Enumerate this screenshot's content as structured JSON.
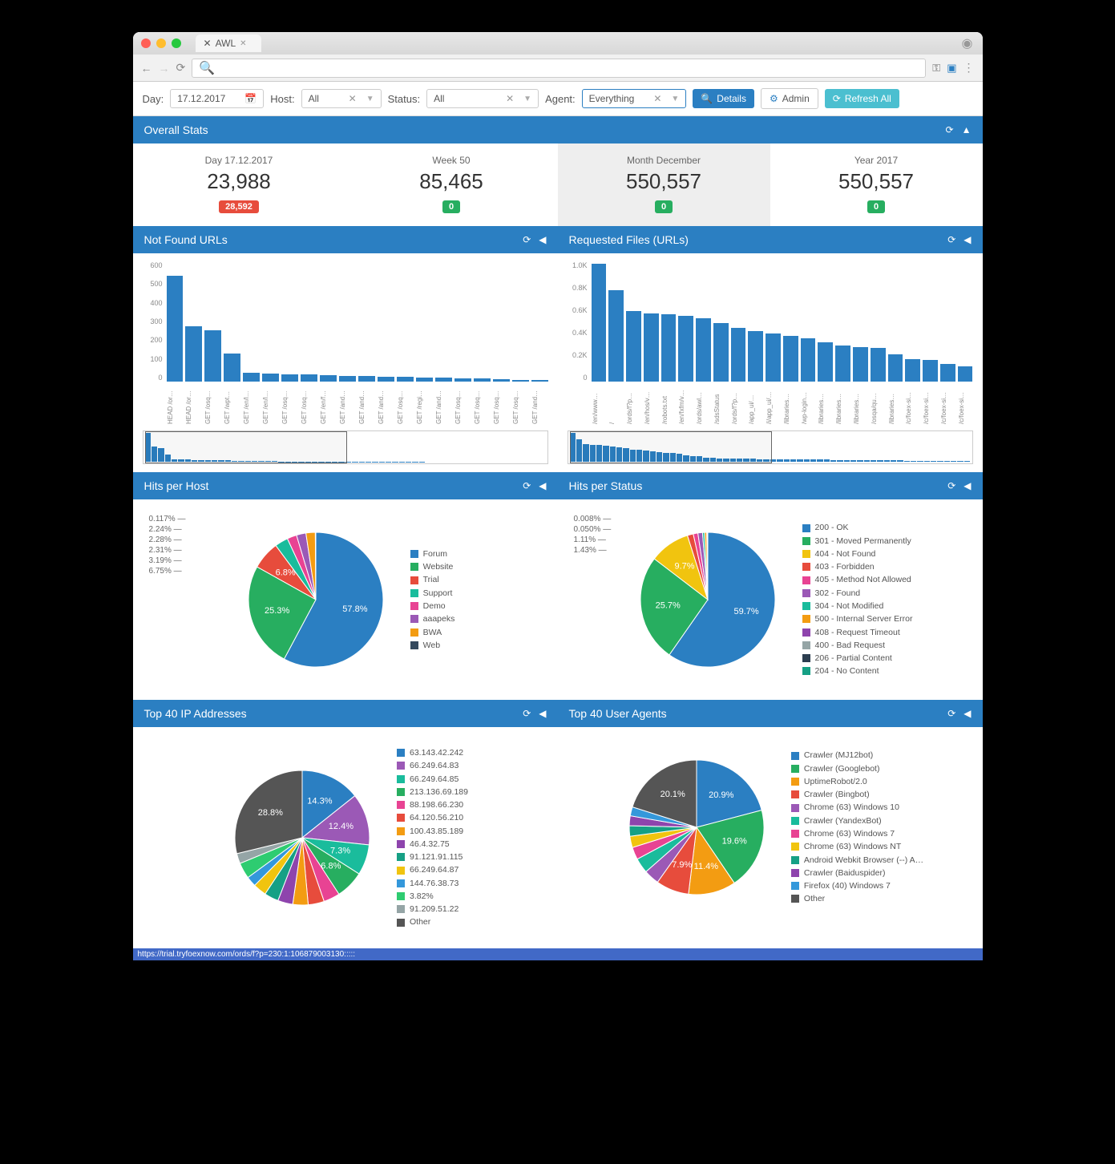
{
  "browser": {
    "tab_title": "AWL",
    "status_text": "https://trial.tryfoexnow.com/ords/f?p=230:1:106879003130:::::"
  },
  "filters": {
    "day_label": "Day:",
    "day_value": "17.12.2017",
    "host_label": "Host:",
    "host_value": "All",
    "status_label": "Status:",
    "status_value": "All",
    "agent_label": "Agent:",
    "agent_value": "Everything",
    "details_btn": "Details",
    "admin_btn": "Admin",
    "refresh_btn": "Refresh All"
  },
  "overall": {
    "title": "Overall Stats",
    "cards": [
      {
        "label": "Day 17.12.2017",
        "value": "23,988",
        "badge": "28,592",
        "badge_color": "red"
      },
      {
        "label": "Week 50",
        "value": "85,465",
        "badge": "0",
        "badge_color": "grn"
      },
      {
        "label": "Month December",
        "value": "550,557",
        "badge": "0",
        "badge_color": "grn",
        "selected": true
      },
      {
        "label": "Year 2017",
        "value": "550,557",
        "badge": "0",
        "badge_color": "grn"
      }
    ]
  },
  "chart_data": [
    {
      "id": "not_found",
      "title": "Not Found URLs",
      "type": "bar",
      "ylabel": "",
      "ylim": [
        0,
        600
      ],
      "yticks": [
        "600",
        "500",
        "400",
        "300",
        "200",
        "100",
        "0"
      ],
      "categories": [
        "HEAD /or…",
        "HEAD /or…",
        "GET /osq…",
        "GET /wpt…",
        "GET /en/l…",
        "GET /en/l…",
        "GET /osq…",
        "GET /osq…",
        "GET /en/f…",
        "GET /and…",
        "GET /and…",
        "GET /and…",
        "GET /osq…",
        "GET /regi…",
        "GET /and…",
        "GET /osq…",
        "GET /osq…",
        "GET /osq…",
        "GET /osq…",
        "GET /and…"
      ],
      "values": [
        530,
        275,
        255,
        140,
        45,
        40,
        38,
        35,
        32,
        30,
        28,
        26,
        24,
        22,
        20,
        18,
        15,
        12,
        10,
        8
      ],
      "minimap_values": [
        530,
        275,
        255,
        140,
        45,
        40,
        38,
        35,
        32,
        30,
        28,
        26,
        24,
        22,
        20,
        18,
        15,
        12,
        10,
        8,
        6,
        6,
        5,
        5,
        5,
        4,
        4,
        4,
        4,
        3,
        3,
        3,
        3,
        3,
        2,
        2,
        2,
        2,
        2,
        2,
        2,
        2,
        1,
        1,
        1,
        1,
        1,
        1,
        1,
        1,
        1,
        1,
        1,
        1,
        1,
        1,
        1,
        1,
        1,
        1
      ]
    },
    {
      "id": "requested",
      "title": "Requested Files (URLs)",
      "type": "bar",
      "ylim": [
        0,
        1000
      ],
      "yticks": [
        "1.0K",
        "0.8K",
        "0.6K",
        "0.4K",
        "0.2K",
        "0"
      ],
      "categories": [
        "/en/www…",
        "/",
        "/ords/f?p…",
        "/en/hos/v…",
        "/robots.txt",
        "/en/fxfm/v…",
        "/ords/awl…",
        "/sdsStatus",
        "/ords/f?p…",
        "/app_ui/…",
        "/i/app_ui/…",
        "/libraries…",
        "/wp-login…",
        "/libraries…",
        "/libraries…",
        "/libraries…",
        "/osqa/qu…",
        "/libraries…",
        "/c/foex-si…",
        "/c/foex-si…",
        "/c/foex-si…",
        "/c/foex-si…"
      ],
      "values": [
        980,
        760,
        590,
        570,
        560,
        550,
        530,
        490,
        450,
        420,
        400,
        380,
        360,
        330,
        300,
        290,
        280,
        230,
        190,
        180,
        150,
        130
      ],
      "minimap_values": [
        980,
        760,
        590,
        570,
        560,
        550,
        530,
        490,
        450,
        420,
        400,
        380,
        360,
        330,
        300,
        290,
        280,
        230,
        190,
        180,
        150,
        130,
        120,
        115,
        110,
        105,
        100,
        98,
        95,
        92,
        90,
        88,
        85,
        82,
        80,
        78,
        75,
        72,
        70,
        68,
        65,
        62,
        60,
        58,
        55,
        52,
        50,
        48,
        45,
        42,
        40,
        38,
        35,
        32,
        30,
        28,
        25,
        22,
        20,
        18
      ]
    },
    {
      "id": "hits_per_host",
      "title": "Hits per Host",
      "type": "pie",
      "series": [
        {
          "name": "Forum",
          "value": 57.8,
          "color": "#2b7fc2"
        },
        {
          "name": "Website",
          "value": 25.3,
          "color": "#27ae60"
        },
        {
          "name": "Trial",
          "value": 6.75,
          "color": "#e74c3c"
        },
        {
          "name": "Support",
          "value": 3.19,
          "color": "#1abc9c"
        },
        {
          "name": "Demo",
          "value": 2.31,
          "color": "#e84393"
        },
        {
          "name": "aaapeks",
          "value": 2.28,
          "color": "#9b59b6"
        },
        {
          "name": "BWA",
          "value": 2.24,
          "color": "#f39c12"
        },
        {
          "name": "Web",
          "value": 0.117,
          "color": "#34495e"
        }
      ],
      "callouts_left": [
        "0.117%",
        "2.24%",
        "2.28%",
        "2.31%",
        "3.19%",
        "6.75%"
      ],
      "slice_labels": [
        "57.8%",
        "25.3%"
      ]
    },
    {
      "id": "hits_per_status",
      "title": "Hits per Status",
      "type": "pie",
      "series": [
        {
          "name": "200 - OK",
          "value": 59.7,
          "color": "#2b7fc2"
        },
        {
          "name": "301 - Moved Permanently",
          "value": 25.7,
          "color": "#27ae60"
        },
        {
          "name": "404 - Not Found",
          "value": 9.71,
          "color": "#f1c40f"
        },
        {
          "name": "403 - Forbidden",
          "value": 1.43,
          "color": "#e74c3c"
        },
        {
          "name": "405 - Method Not Allowed",
          "value": 1.11,
          "color": "#e84393"
        },
        {
          "name": "302 - Found",
          "value": 1.11,
          "color": "#9b59b6"
        },
        {
          "name": "304 - Not Modified",
          "value": 0.5,
          "color": "#1abc9c"
        },
        {
          "name": "500 - Internal Server Error",
          "value": 0.5,
          "color": "#f39c12"
        },
        {
          "name": "408 - Request Timeout",
          "value": 0.1,
          "color": "#8e44ad"
        },
        {
          "name": "400 - Bad Request",
          "value": 0.05,
          "color": "#95a5a6"
        },
        {
          "name": "206 - Partial Content",
          "value": 0.05,
          "color": "#2c3e50"
        },
        {
          "name": "204 - No Content",
          "value": 0.05,
          "color": "#16a085"
        }
      ],
      "callouts_left": [
        "0.008%",
        "0.050%",
        "1.11%",
        "1.43%"
      ],
      "slice_labels": [
        "59.7%",
        "25.7%",
        "9.71%"
      ]
    },
    {
      "id": "top_ip",
      "title": "Top 40 IP Addresses",
      "type": "pie",
      "series": [
        {
          "name": "63.143.42.242",
          "value": 14.3,
          "color": "#2b7fc2"
        },
        {
          "name": "66.249.64.83",
          "value": 12.4,
          "color": "#9b59b6"
        },
        {
          "name": "66.249.64.85",
          "value": 7.32,
          "color": "#1abc9c"
        },
        {
          "name": "213.136.69.189",
          "value": 6.8,
          "color": "#27ae60"
        },
        {
          "name": "88.198.66.230",
          "value": 3.91,
          "color": "#e84393"
        },
        {
          "name": "64.120.56.210",
          "value": 3.85,
          "color": "#e74c3c"
        },
        {
          "name": "100.43.85.189",
          "value": 3.68,
          "color": "#f39c12"
        },
        {
          "name": "46.4.32.75",
          "value": 3.61,
          "color": "#8e44ad"
        },
        {
          "name": "91.121.91.115",
          "value": 3.42,
          "color": "#16a085"
        },
        {
          "name": "66.249.64.87",
          "value": 3.2,
          "color": "#f1c40f"
        },
        {
          "name": "144.76.38.73",
          "value": 2.46,
          "color": "#3498db"
        },
        {
          "name": "3.82%",
          "value": 3.82,
          "color": "#2ecc71"
        },
        {
          "name": "91.209.51.22",
          "value": 2.44,
          "color": "#95a5a6"
        },
        {
          "name": "Other",
          "value": 28.8,
          "color": "#555"
        }
      ],
      "legend_items": [
        "63.143.42.242",
        "66.249.64.83",
        "66.249.64.85",
        "213.136.69.189",
        "88.198.66.230",
        "64.120.56.210",
        "100.43.85.189",
        "46.4.32.75",
        "91.121.91.115",
        "66.249.64.87",
        "144.76.38.73",
        "3.82%",
        "91.209.51.22",
        "Other"
      ],
      "callouts": [
        "14.3%",
        "12.4%",
        "7.32%",
        "6.80%",
        "3.91%",
        "3.85%",
        "3.68%",
        "3.61%",
        "3.42%",
        "3.20%",
        "2.46%",
        "2.44%",
        "28.8%"
      ]
    },
    {
      "id": "top_agents",
      "title": "Top 40 User Agents",
      "type": "pie",
      "series": [
        {
          "name": "Crawler (MJ12bot)",
          "value": 20.9,
          "color": "#2b7fc2"
        },
        {
          "name": "Crawler (Googlebot)",
          "value": 19.6,
          "color": "#27ae60"
        },
        {
          "name": "UptimeRobot/2.0",
          "value": 11.4,
          "color": "#f39c12"
        },
        {
          "name": "Crawler (Bingbot)",
          "value": 7.92,
          "color": "#e74c3c"
        },
        {
          "name": "Chrome (63) Windows 10",
          "value": 3.68,
          "color": "#9b59b6"
        },
        {
          "name": "Crawler (YandexBot)",
          "value": 3.63,
          "color": "#1abc9c"
        },
        {
          "name": "Chrome (63) Windows 7",
          "value": 2.98,
          "color": "#e84393"
        },
        {
          "name": "Chrome (63) Windows NT",
          "value": 2.72,
          "color": "#f1c40f"
        },
        {
          "name": "Android Webkit Browser (--) A…",
          "value": 2.5,
          "color": "#16a085"
        },
        {
          "name": "Crawler (Baiduspider)",
          "value": 2.38,
          "color": "#8e44ad"
        },
        {
          "name": "Firefox (40) Windows 7",
          "value": 2.14,
          "color": "#3498db"
        },
        {
          "name": "Other",
          "value": 20.1,
          "color": "#555"
        }
      ],
      "callouts": [
        "20.9%",
        "19.6%",
        "11.4%",
        "7.92%",
        "3.68%",
        "3.63%",
        "2.98%",
        "2.72%",
        "2.50%",
        "2.38%",
        "2.14%",
        "20.1%"
      ]
    }
  ]
}
